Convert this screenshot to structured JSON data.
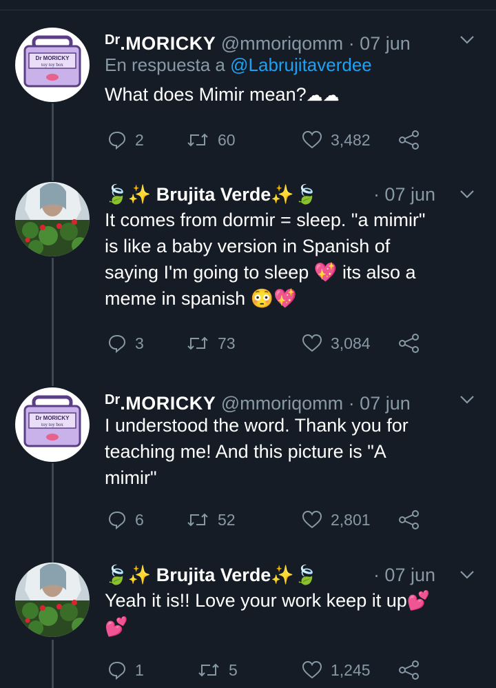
{
  "tweets": [
    {
      "author_prefix": "Dr",
      "author_name": ".MORICKY",
      "handle": "@mmoriqomm",
      "date": "· 07 jun",
      "reply_prefix": "En respuesta a",
      "reply_link": "@Labrujitaverdee",
      "text": "What does Mimir mean?",
      "text_emoji": "☁☁",
      "replies": "2",
      "retweets": "60",
      "likes": "3,482",
      "avatar_label_1": "Dr MORICKY",
      "avatar_label_2": "toy toy box"
    },
    {
      "author_left_emoji": "🍃✨",
      "author_name": "Brujita Verde",
      "author_right_emoji": "✨🍃",
      "date": "· 07 jun",
      "text_lines": [
        "It comes from dormir = sleep. \"a mimir\"",
        "is like a baby version in Spanish of",
        "saying I'm going to sleep 💖 its also a",
        "meme in spanish 😳💖"
      ],
      "replies": "3",
      "retweets": "73",
      "likes": "3,084"
    },
    {
      "author_prefix": "Dr",
      "author_name": ".MORICKY",
      "handle": "@mmoriqomm",
      "date": "· 07 jun",
      "text_lines": [
        "I understood the word. Thank you for",
        "teaching me! And this picture is \"A",
        "mimir\""
      ],
      "replies": "6",
      "retweets": "52",
      "likes": "2,801",
      "avatar_label_1": "Dr MORICKY",
      "avatar_label_2": "toy toy box"
    },
    {
      "author_left_emoji": "🍃✨",
      "author_name": "Brujita Verde",
      "author_right_emoji": "✨🍃",
      "date": "· 07 jun",
      "text_lines": [
        "Yeah it is!! Love your work keep it up💕",
        "💕"
      ],
      "replies": "1",
      "retweets": "5",
      "likes": "1,245"
    }
  ],
  "icons": {
    "reply": "reply-icon",
    "retweet": "retweet-icon",
    "like": "heart-icon",
    "share": "share-icon",
    "menu": "chevron-down-icon"
  },
  "colors": {
    "background": "#151c26",
    "secondary_text": "#8899a6",
    "link": "#1da1f2",
    "thread_line": "#3d4854"
  }
}
